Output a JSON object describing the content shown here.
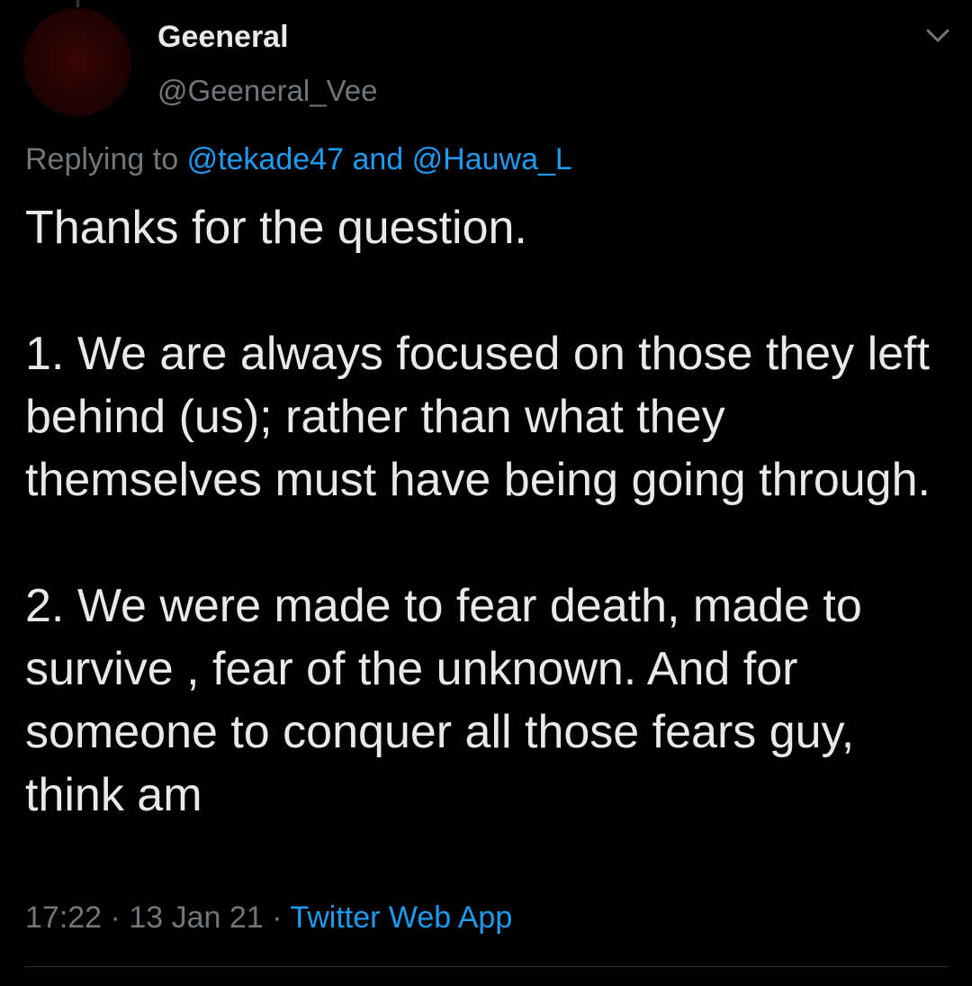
{
  "tweet": {
    "author": {
      "display_name": "Geeneral",
      "handle": "@Geeneral_Vee"
    },
    "replying": {
      "prefix": "Replying to",
      "mention_1": "@tekade47",
      "conjunction": "and",
      "mention_2": "@Hauwa_L"
    },
    "paragraphs": [
      "Thanks for the question.",
      "1. We are always focused on those they left behind (us);  rather than what they themselves must have being going through.",
      "2. We were made to fear death, made to survive , fear of the unknown. And for someone to conquer all those fears guy, think am"
    ],
    "meta": {
      "time": "17:22",
      "date": "13 Jan 21",
      "source": "Twitter Web App",
      "separator": "·"
    }
  },
  "icons": {
    "more_menu": "chevron-down-icon"
  },
  "colors": {
    "background": "#000000",
    "primary_text": "#e7e9ea",
    "secondary_text": "#71767b",
    "link": "#1d9bf0",
    "avatar": "#2a0303"
  }
}
